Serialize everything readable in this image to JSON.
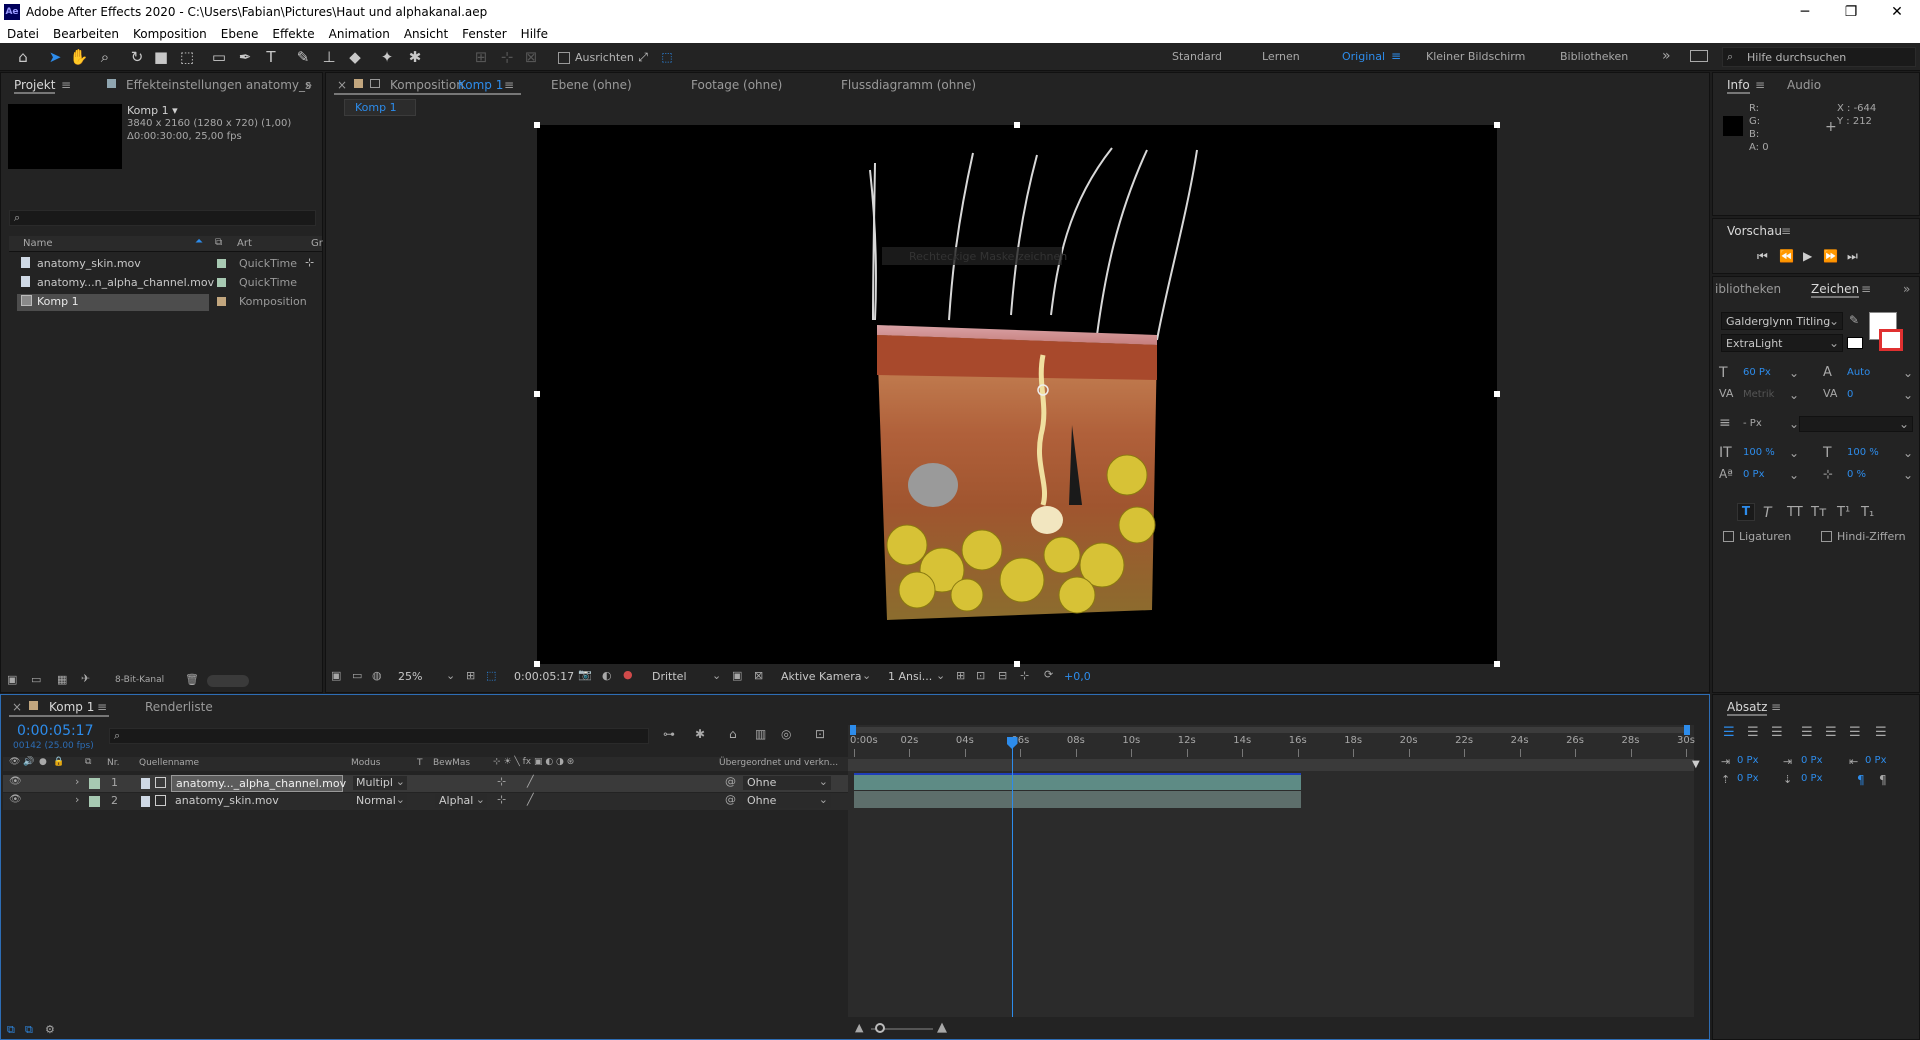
{
  "window": {
    "title": "Adobe After Effects 2020 - C:\\Users\\Fabian\\Pictures\\Haut und alphakanal.aep",
    "app_icon": "Ae",
    "controls": [
      "─",
      "❐",
      "✕"
    ]
  },
  "menu": [
    "Datei",
    "Bearbeiten",
    "Komposition",
    "Ebene",
    "Effekte",
    "Animation",
    "Ansicht",
    "Fenster",
    "Hilfe"
  ],
  "toolbar": {
    "align_label": "Ausrichten",
    "workspaces": [
      "Standard",
      "Lernen",
      "Original",
      "Kleiner Bildschirm",
      "Bibliotheken"
    ],
    "active_workspace": "Original",
    "overflow": "»",
    "search_placeholder": "Hilfe durchsuchen"
  },
  "project": {
    "tab": "Projekt",
    "effects_tab": "Effekteinstellungen anatomy_s",
    "comp_name": "Komp 1 ▾",
    "comp_info_1": "3840 x 2160 (1280 x 720) (1,00)",
    "comp_info_2": "Δ0:00:30:00, 25,00 fps",
    "col_name": "Name",
    "col_type": "Art",
    "col_gr": "Gr",
    "items": [
      {
        "name": "anatomy_skin.mov",
        "type": "QuickTime",
        "selected": false
      },
      {
        "name": "anatomy...n_alpha_channel.mov",
        "type": "QuickTime",
        "selected": false
      },
      {
        "name": "Komp 1",
        "type": "Komposition",
        "selected": true
      }
    ],
    "bit_depth": "8-Bit-Kanal"
  },
  "comp_panel": {
    "tab_prefix": "Komposition",
    "tab_comp": "Komp 1",
    "layer_tab": "Ebene (ohne)",
    "footage_tab": "Footage (ohne)",
    "flow_tab": "Flussdiagramm (ohne)",
    "crumb": "Komp 1",
    "ghost_text": "Rechteckige Maske zeichnen",
    "zoom": "25%",
    "timecode": "0:00:05:17",
    "resolution": "Drittel",
    "camera": "Aktive Kamera",
    "views": "1 Ansi...",
    "exposure": "+0,0"
  },
  "info": {
    "tab": "Info",
    "audio_tab": "Audio",
    "r": "R:",
    "g": "G:",
    "b": "B:",
    "a": "A:  0",
    "x": "X : -644",
    "y": "Y : 212"
  },
  "preview": {
    "title": "Vorschau"
  },
  "character": {
    "lib_tab": "ibliotheken",
    "tab": "Zeichen",
    "font": "Galderglynn Titling",
    "style": "ExtraLight",
    "size": "60 Px",
    "leading": "Auto",
    "kerning": "Metrik",
    "tracking": "0",
    "stroke": "- Px",
    "vscale": "100 %",
    "hscale": "100 %",
    "baseline": "0 Px",
    "tsume": "0 %",
    "ligatures": "Ligaturen",
    "hindi": "Hindi-Ziffern"
  },
  "paragraph": {
    "tab": "Absatz",
    "indent_left": "0 Px",
    "indent_first": "0 Px",
    "indent_right": "0 Px",
    "space_before": "0 Px",
    "space_after": "0 Px"
  },
  "timeline": {
    "tab": "Komp 1",
    "render_tab": "Renderliste",
    "timecode": "0:00:05:17",
    "frame_info": "00142 (25.00 fps)",
    "cols": {
      "nr": "Nr.",
      "source": "Quellenname",
      "mode": "Modus",
      "t": "T",
      "trkmat": "BewMas",
      "parent": "Übergeordnet und verkn..."
    },
    "ruler": [
      "0:00s",
      "02s",
      "04s",
      "06s",
      "08s",
      "10s",
      "12s",
      "14s",
      "16s",
      "18s",
      "20s",
      "22s",
      "24s",
      "26s",
      "28s",
      "30s"
    ],
    "layers": [
      {
        "nr": "1",
        "name": "anatomy..._alpha_channel.mov",
        "mode": "Multipl",
        "trkmat": "",
        "parent": "Ohne",
        "selected": true
      },
      {
        "nr": "2",
        "name": "anatomy_skin.mov",
        "mode": "Normal",
        "trkmat": "Alphal",
        "parent": "Ohne",
        "selected": false
      }
    ],
    "playhead_seconds": 5.68,
    "duration_seconds": 30,
    "clip_end_seconds": 16.1
  }
}
